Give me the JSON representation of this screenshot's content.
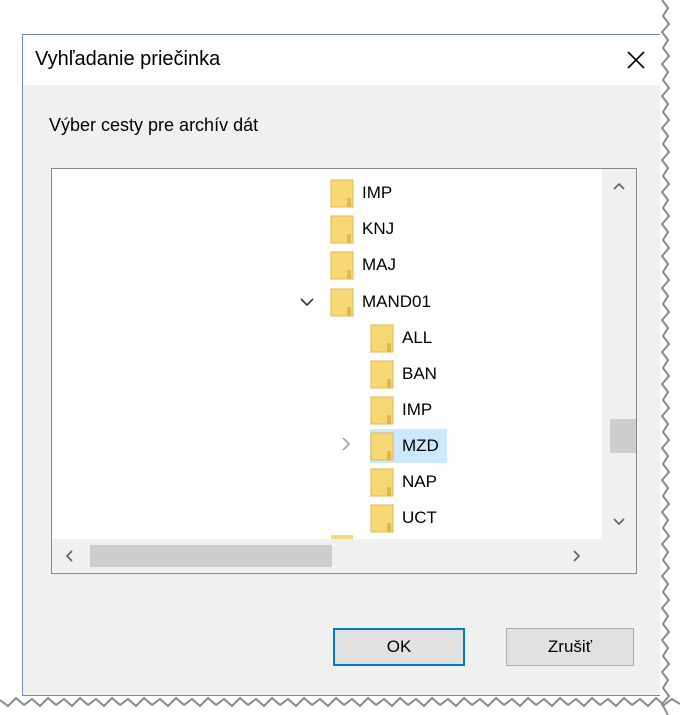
{
  "dialog": {
    "title": "Vyhľadanie priečinka",
    "instruction": "Výber cesty pre archív dát",
    "ok_label": "OK",
    "cancel_label": "Zrušiť"
  },
  "tree": {
    "items": [
      {
        "label": "IMP"
      },
      {
        "label": "KNJ"
      },
      {
        "label": "MAJ"
      },
      {
        "label": "MAND01",
        "expanded": true
      },
      {
        "label": "ALL"
      },
      {
        "label": "BAN"
      },
      {
        "label": "IMP"
      },
      {
        "label": "MZD",
        "selected": true,
        "collapsed_expander": true
      },
      {
        "label": "NAP"
      },
      {
        "label": "UCT"
      }
    ]
  },
  "colors": {
    "selection": "#cce8ff",
    "accent": "#0078d7",
    "folder": "#f8d775"
  }
}
